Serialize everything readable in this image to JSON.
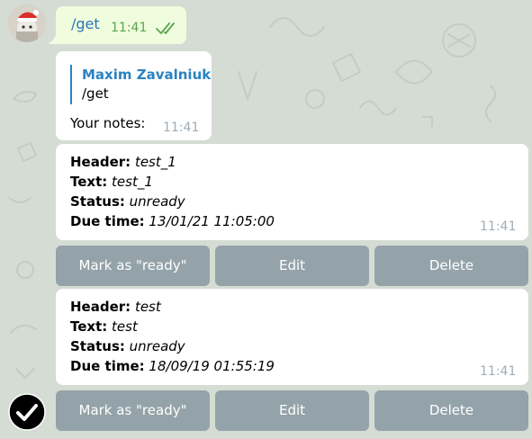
{
  "chat": {
    "outgoing": {
      "command": "/get",
      "time": "11:41",
      "status_icon": "double-check-icon"
    },
    "reply": {
      "author": "Maxim Zavalniuk",
      "quoted_text": "/get",
      "text": "Your notes:",
      "time": "11:41"
    },
    "notes": [
      {
        "header_label": "Header:",
        "header_value": "test_1",
        "text_label": "Text:",
        "text_value": "test_1",
        "status_label": "Status:",
        "status_value": "unready",
        "due_label": "Due time:",
        "due_value": "13/01/21 11:05:00",
        "time": "11:41",
        "buttons": {
          "mark_ready": "Mark as \"ready\"",
          "edit": "Edit",
          "delete": "Delete"
        }
      },
      {
        "header_label": "Header:",
        "header_value": "test",
        "text_label": "Text:",
        "text_value": "test",
        "status_label": "Status:",
        "status_value": "unready",
        "due_label": "Due time:",
        "due_value": "18/09/19 01:55:19",
        "time": "11:41",
        "buttons": {
          "mark_ready": "Mark as \"ready\"",
          "edit": "Edit",
          "delete": "Delete"
        }
      }
    ]
  },
  "colors": {
    "background": "#d4dcd3",
    "outgoing_bubble": "#effdde",
    "incoming_bubble": "#ffffff",
    "link_blue": "#2a78b4",
    "outgoing_time_green": "#5ea24f",
    "incoming_time_gray": "#a0acb6",
    "keyboard_button": "#82949e"
  },
  "icons": {
    "avatar": "bot-avatar-santa-hat",
    "select_badge": "check-circle-icon"
  }
}
